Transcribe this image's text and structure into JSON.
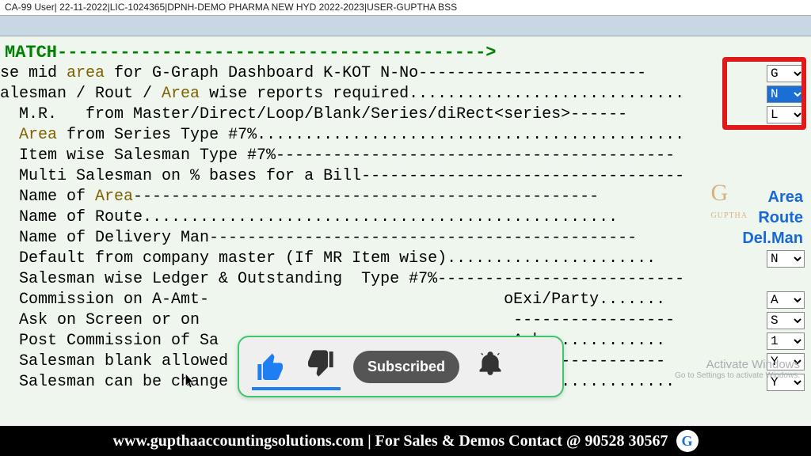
{
  "titlebar": "CA-99 User| 22-11-2022|LIC-1024365|DPNH-DEMO PHARMA NEW HYD 2022-2023|USER-GUPTHA BSS",
  "header": {
    "label": " MATCH",
    "dashes": "----------------------------------------->"
  },
  "rows": {
    "r1a": "se mid ",
    "r1b": "area",
    "r1c": " for G-Graph Dashboard K-KOT N-No------------------------",
    "r2a": "alesman / Rout / ",
    "r2b": "Area",
    "r2c": " wise reports required.............................",
    "r3a": "  M.R.   from Master/Direct/Loop/Blank/Series/diRect<series>------",
    "r4a": "  ",
    "r4b": "Area",
    "r4c": " from Series Type #7%.............................................",
    "r5": "  Item wise Salesman Type #7%------------------------------------------",
    "r6": "  Multi Salesman on % bases for a Bill----------------------------------",
    "r7a": "  Name of ",
    "r7b": "Area",
    "r7c": "-------------------------------------------------",
    "r8": "  Name of Route..................................................",
    "r9": "  Name of Delivery Man---------------------------------------------",
    "r10": "  Default from company master (If MR Item wise)......................",
    "r11": "  Salesman wise Ledger & Outstanding  Type #7%--------------------------",
    "r12": "  Commission on A-Amt-                               oExi/Party.......",
    "r13": "  Ask on Screen or on                                 -----------------",
    "r14": "  Post Commission of Sa                              -Ask.............",
    "r15": "  Salesman blank allowed in Sales Bills & Stock Add-------------------",
    "r16": "  Salesman can be change in bill modification.........................."
  },
  "endlabels": {
    "area": "Area",
    "route": "Route",
    "delman": "Del.Man"
  },
  "selects": {
    "s1": "G",
    "s2": "N",
    "s3": "L",
    "s10": "N",
    "s12": "A",
    "s13": "S",
    "s14": "1",
    "s15": "Y",
    "s16": "Y"
  },
  "overlay": {
    "subscribed": "Subscribed"
  },
  "activate": {
    "l1": "Activate Windows",
    "l2": "Go to Settings to activate Windows."
  },
  "watermark": {
    "big": "G",
    "line": "GUPTHA"
  },
  "footer": "www.gupthaaccountingsolutions.com | For Sales & Demos Contact @ 90528 30567"
}
